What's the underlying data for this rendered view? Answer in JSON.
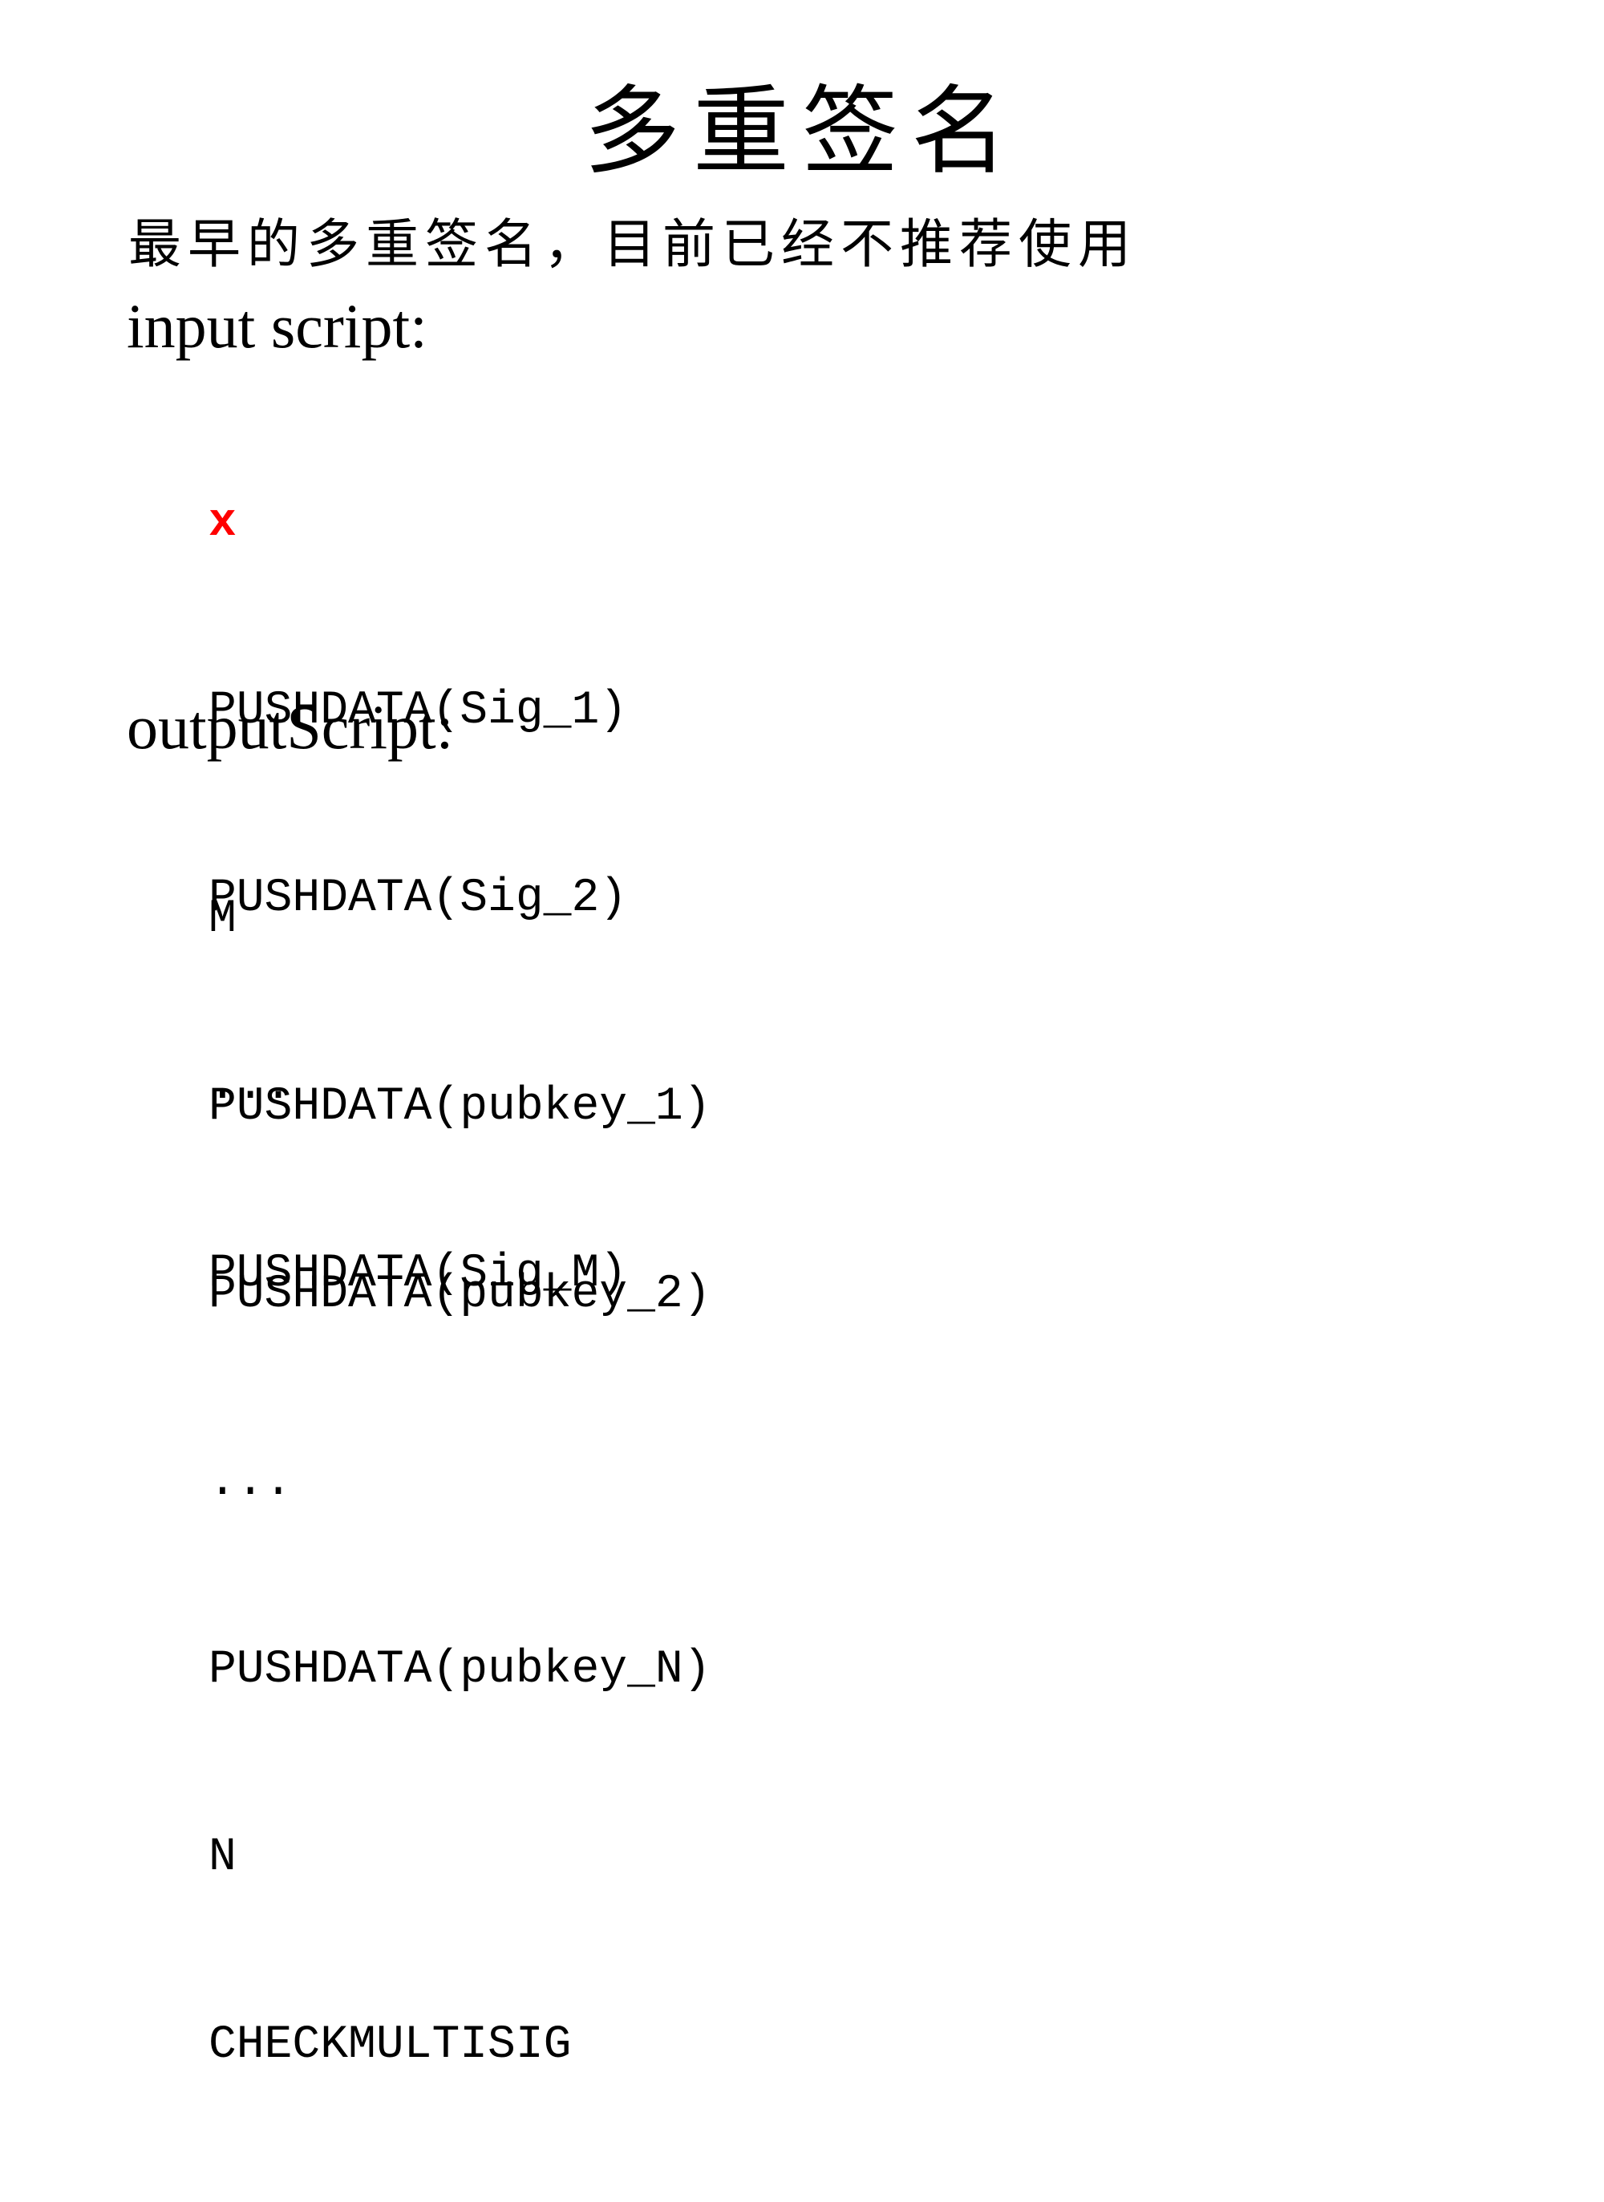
{
  "slide": {
    "title": "多重签名",
    "subtitle": "最早的多重签名，目前已经不推荐使用",
    "input_heading": "input script:",
    "input_lines": [
      "x",
      "PUSHDATA(Sig_1)",
      "PUSHDATA(Sig_2)",
      "...",
      "PUSHDATA(Sig_M)"
    ],
    "output_heading": "outputScript:",
    "output_lines": [
      "M",
      "PUSHDATA(pubkey_1)",
      "PUSHDATA(pubkey_2)",
      "...",
      "PUSHDATA(pubkey_N)",
      "N",
      "CHECKMULTISIG"
    ],
    "colors": {
      "text": "#000000",
      "marker": "#ff0000",
      "background": "#ffffff"
    }
  }
}
